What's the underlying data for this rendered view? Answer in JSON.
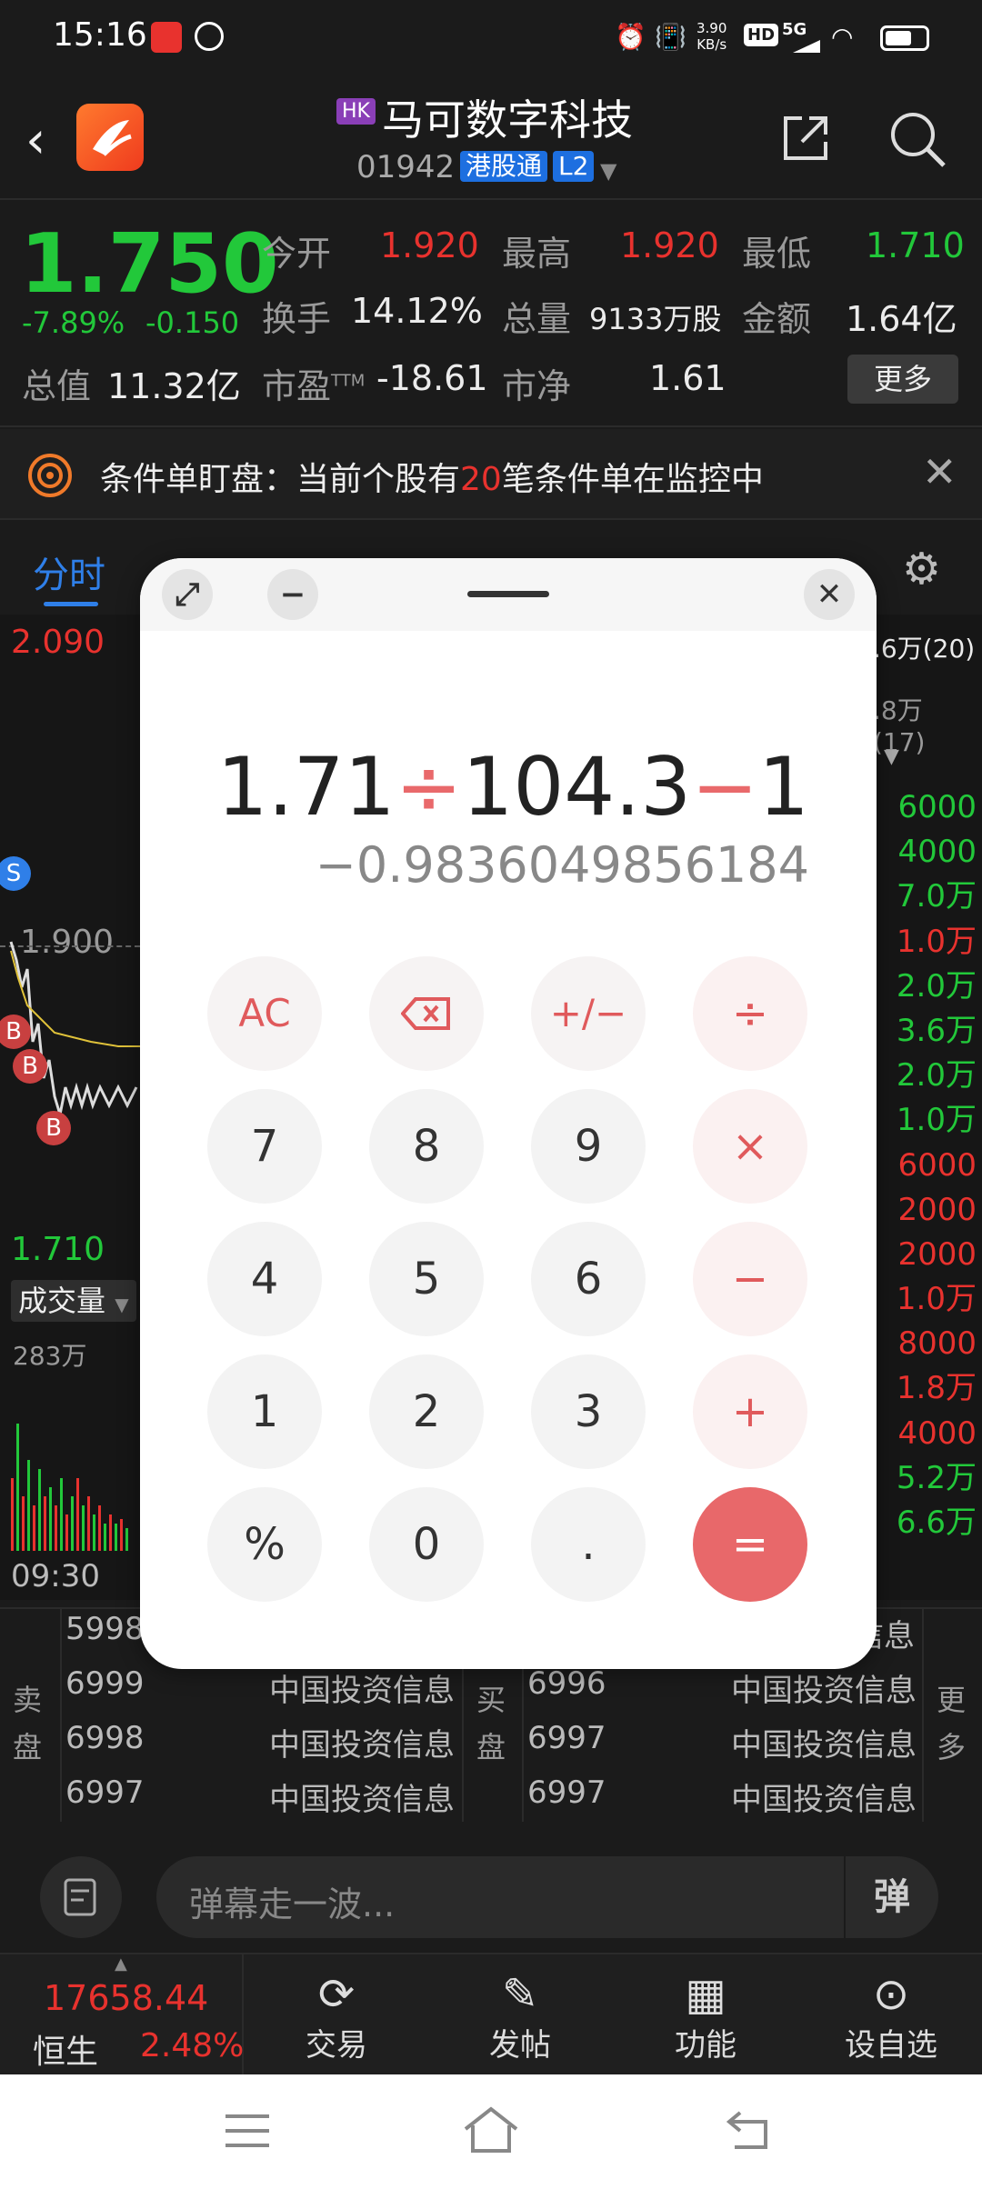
{
  "status_bar": {
    "time": "15:16",
    "net_speed_value": "3.90",
    "net_speed_unit": "KB/s",
    "hd": "HD",
    "signal": "5G"
  },
  "header": {
    "market_tag": "HK",
    "stock_name": "马可数字科技",
    "stock_code": "01942",
    "connect_tag": "港股通",
    "level_tag": "L2"
  },
  "quote": {
    "price": "1.750",
    "change_pct": "-7.89%",
    "change_abs": "-0.150",
    "open_label": "今开",
    "open_value": "1.920",
    "high_label": "最高",
    "high_value": "1.920",
    "low_label": "最低",
    "low_value": "1.710",
    "turnover_label": "换手",
    "turnover_value": "14.12%",
    "volume_label": "总量",
    "volume_value": "9133万股",
    "amount_label": "金额",
    "amount_value": "1.64亿",
    "mktcap_label": "总值",
    "mktcap_value": "11.32亿",
    "pe_label": "市盈",
    "pe_sup": "TTM",
    "pe_value": "-18.61",
    "pb_label": "市净",
    "pb_value": "1.61",
    "more_label": "更多"
  },
  "notice": {
    "text_prefix": "条件单盯盘：当前个股有",
    "count": "20",
    "text_suffix": "笔条件单在监控中"
  },
  "tabs": {
    "active": "分时"
  },
  "chart": {
    "high_label": "2.090",
    "mid_label": "1.900",
    "low_label": "1.710",
    "volume_selector": "成交量",
    "volume_max": "283万",
    "time_start": "09:30",
    "marker_s": "S",
    "marker_b": "B",
    "right_top": [
      {
        "text": ".6万(20)",
        "color": "#ececec"
      },
      {
        "text": ".8万 (17)",
        "color": "#9a9a9a"
      }
    ],
    "right_list": [
      {
        "text": "6000",
        "color": "#22c83a"
      },
      {
        "text": "4000",
        "color": "#22c83a"
      },
      {
        "text": "7.0万",
        "color": "#22c83a"
      },
      {
        "text": "1.0万",
        "color": "#e8322e"
      },
      {
        "text": "2.0万",
        "color": "#22c83a"
      },
      {
        "text": "3.6万",
        "color": "#22c83a"
      },
      {
        "text": "2.0万",
        "color": "#22c83a"
      },
      {
        "text": "1.0万",
        "color": "#22c83a"
      },
      {
        "text": "6000",
        "color": "#e8322e"
      },
      {
        "text": "2000",
        "color": "#e8322e"
      },
      {
        "text": "2000",
        "color": "#e8322e"
      },
      {
        "text": "1.0万",
        "color": "#e8322e"
      },
      {
        "text": "8000",
        "color": "#e8322e"
      },
      {
        "text": "1.8万",
        "color": "#e8322e"
      },
      {
        "text": "4000",
        "color": "#e8322e"
      },
      {
        "text": "5.2万",
        "color": "#22c83a"
      },
      {
        "text": "6.6万",
        "color": "#22c83a"
      }
    ]
  },
  "orderbook": {
    "sell_label_1": "卖",
    "sell_label_2": "盘",
    "buy_label_1": "买",
    "buy_label_2": "盘",
    "more_1": "更",
    "more_2": "多",
    "broker_top_right": "信息",
    "sell_rows": [
      {
        "code": "5998",
        "name": ""
      },
      {
        "code": "6999",
        "name": "中国投资信息"
      },
      {
        "code": "6998",
        "name": "中国投资信息"
      },
      {
        "code": "6997",
        "name": "中国投资信息"
      }
    ],
    "buy_rows": [
      {
        "code": "6996",
        "name": "中国投资信息"
      },
      {
        "code": "6997",
        "name": "中国投资信息"
      },
      {
        "code": "6997",
        "name": "中国投资信息"
      }
    ]
  },
  "comment": {
    "placeholder": "弹幕走一波...",
    "danmu_btn": "弹"
  },
  "toolbar": {
    "index_value": "17658.44",
    "index_name": "恒生",
    "index_change": "2.48%",
    "trade": "交易",
    "post": "发帖",
    "functions": "功能",
    "watchlist": "设自选"
  },
  "calculator": {
    "expr_1": "1.71",
    "op_1": "÷",
    "expr_2": "104.3",
    "op_2": "−",
    "expr_3": "1",
    "result": "−0.9836049856184",
    "keys": {
      "ac": "AC",
      "sign": "+/−",
      "div": "÷",
      "k7": "7",
      "k8": "8",
      "k9": "9",
      "mul": "×",
      "k4": "4",
      "k5": "5",
      "k6": "6",
      "sub": "−",
      "k1": "1",
      "k2": "2",
      "k3": "3",
      "add": "+",
      "pct": "%",
      "k0": "0",
      "dot": ".",
      "eq": "="
    }
  }
}
